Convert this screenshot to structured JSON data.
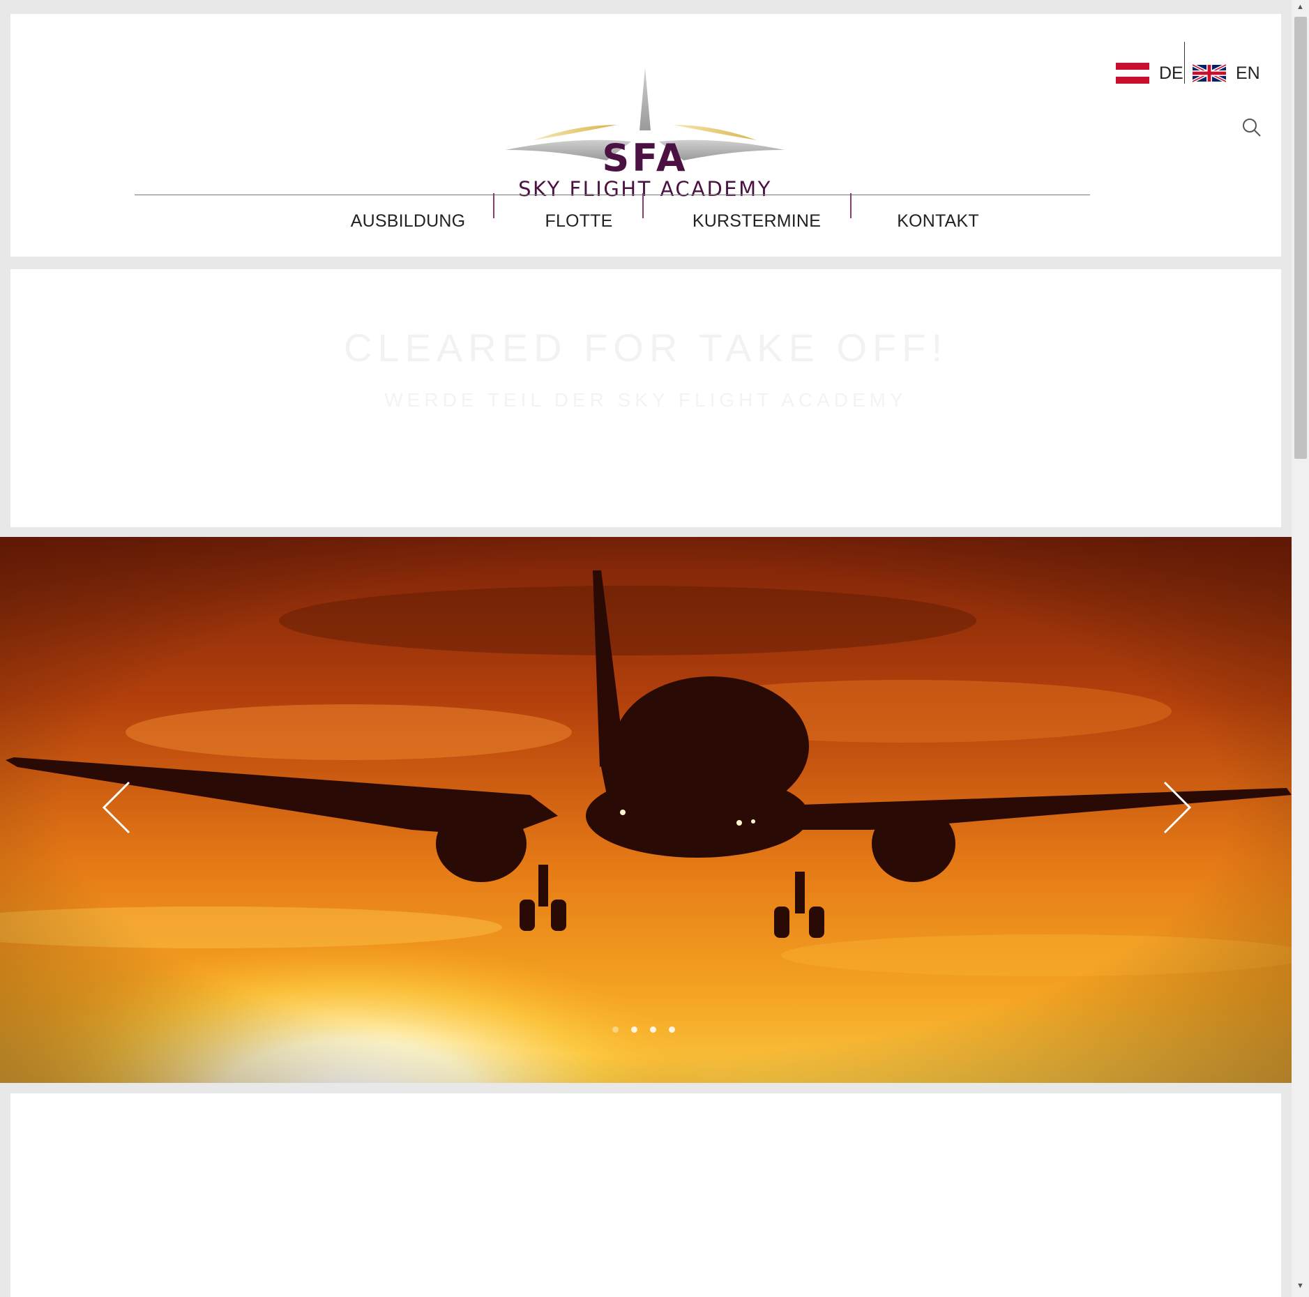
{
  "header": {
    "brand_initials": "SFA",
    "brand_name": "SKY FLIGHT ACADEMY",
    "nav": [
      {
        "label": "AUSBILDUNG"
      },
      {
        "label": "FLOTTE"
      },
      {
        "label": "KURSTERMINE"
      },
      {
        "label": "KONTAKT"
      }
    ],
    "languages": [
      {
        "code": "DE",
        "flag": "austria-flag"
      },
      {
        "code": "EN",
        "flag": "uk-flag"
      }
    ],
    "search_icon": "search-icon",
    "accent_color": "#4b1142",
    "separator_color": "#8c3b6e"
  },
  "intro": {
    "title": "CLEARED FOR TAKE OFF!",
    "subtitle": "WERDE TEIL DER SKY FLIGHT ACADEMY"
  },
  "slider": {
    "slide_count": 4,
    "active_index": 0,
    "prev_icon": "chevron-left-icon",
    "next_icon": "chevron-right-icon"
  }
}
